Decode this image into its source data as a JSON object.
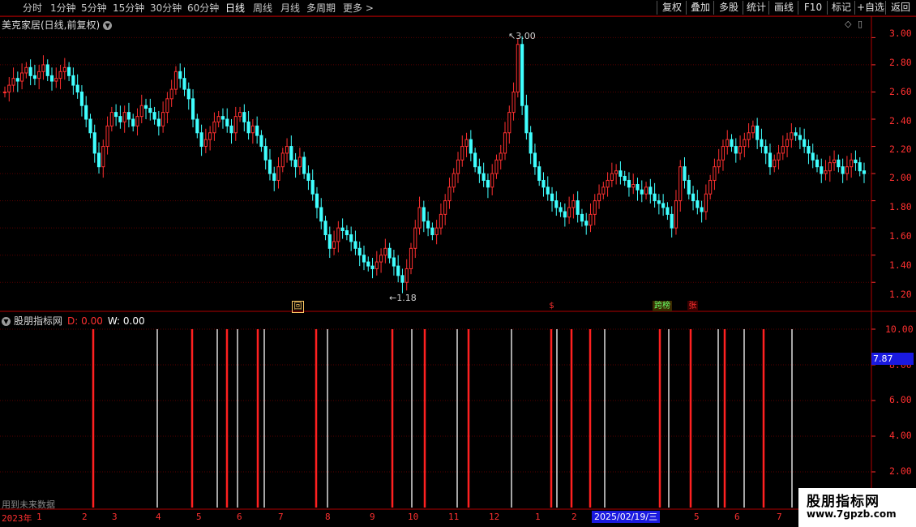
{
  "toolbar": {
    "periods": [
      "分时",
      "1分钟",
      "5分钟",
      "15分钟",
      "30分钟",
      "60分钟",
      "日线",
      "周线",
      "月线",
      "多周期",
      "更多"
    ],
    "active_period": "日线",
    "right_buttons": [
      "复权",
      "叠加",
      "多股",
      "统计",
      "画线",
      "F10",
      "标记",
      "+自选",
      "返回"
    ]
  },
  "main": {
    "title": "美克家居(日线,前复权)",
    "high_label": "3.00",
    "low_label": "1.18",
    "y_ticks": [
      "3.00",
      "2.80",
      "2.60",
      "2.40",
      "2.20",
      "2.00",
      "1.80",
      "1.60",
      "1.40",
      "1.20"
    ],
    "signals": [
      {
        "text": "回",
        "color": "#ffcc66"
      },
      {
        "text": "$",
        "color": "#ff3030"
      },
      {
        "text": "跨榜",
        "color": "#66ff66"
      },
      {
        "text": "张",
        "color": "#ff3030"
      }
    ]
  },
  "indicator": {
    "title": "股朋指标网",
    "d_label": "D: 0.00",
    "w_label": "W: 0.00",
    "y_ticks": [
      "10.00",
      "8.00",
      "6.00",
      "4.00",
      "2.00"
    ],
    "current_value": "7.87",
    "future_note": "用到未来数据"
  },
  "time_axis": {
    "labels": [
      "2023年",
      "1",
      "2",
      "3",
      "4",
      "5",
      "6",
      "7",
      "8",
      "9",
      "10",
      "11",
      "12",
      "1",
      "2",
      "5",
      "6",
      "7"
    ],
    "cursor_date": "2025/02/19/三"
  },
  "watermark": {
    "line1": "股朋指标网",
    "line2": "www.7gpzb.com"
  },
  "colors": {
    "up": "#ff3030",
    "down": "#40ffff",
    "bg": "#000000",
    "grid": "#5a0000",
    "white": "#ffffff"
  },
  "chart_data": {
    "type": "candlestick",
    "ylim": [
      1.1,
      3.05
    ],
    "closes": [
      2.6,
      2.65,
      2.7,
      2.68,
      2.74,
      2.78,
      2.72,
      2.7,
      2.75,
      2.8,
      2.72,
      2.68,
      2.7,
      2.75,
      2.78,
      2.72,
      2.65,
      2.6,
      2.5,
      2.4,
      2.3,
      2.15,
      2.05,
      2.2,
      2.35,
      2.45,
      2.42,
      2.38,
      2.45,
      2.4,
      2.35,
      2.42,
      2.5,
      2.48,
      2.45,
      2.4,
      2.35,
      2.45,
      2.55,
      2.62,
      2.75,
      2.7,
      2.62,
      2.55,
      2.4,
      2.3,
      2.2,
      2.25,
      2.3,
      2.38,
      2.42,
      2.4,
      2.35,
      2.3,
      2.42,
      2.45,
      2.38,
      2.3,
      2.35,
      2.28,
      2.2,
      2.1,
      2.0,
      1.95,
      2.05,
      2.15,
      2.2,
      2.1,
      2.05,
      2.12,
      2.0,
      1.95,
      1.85,
      1.75,
      1.65,
      1.55,
      1.45,
      1.5,
      1.6,
      1.58,
      1.55,
      1.5,
      1.45,
      1.4,
      1.35,
      1.32,
      1.3,
      1.35,
      1.4,
      1.45,
      1.38,
      1.32,
      1.25,
      1.2,
      1.3,
      1.45,
      1.6,
      1.75,
      1.65,
      1.6,
      1.55,
      1.6,
      1.7,
      1.8,
      1.9,
      2.0,
      2.1,
      2.2,
      2.25,
      2.15,
      2.05,
      2.0,
      1.95,
      1.9,
      2.0,
      2.1,
      2.15,
      2.3,
      2.45,
      2.6,
      2.95,
      2.5,
      2.3,
      2.15,
      2.05,
      1.95,
      1.9,
      1.85,
      1.8,
      1.75,
      1.72,
      1.68,
      1.75,
      1.8,
      1.7,
      1.65,
      1.62,
      1.7,
      1.8,
      1.85,
      1.9,
      1.95,
      2.0,
      2.02,
      1.98,
      1.95,
      1.9,
      1.92,
      1.88,
      1.85,
      1.9,
      1.85,
      1.8,
      1.78,
      1.75,
      1.7,
      1.6,
      1.8,
      2.05,
      1.95,
      1.85,
      1.8,
      1.75,
      1.72,
      1.85,
      1.95,
      2.05,
      2.1,
      2.2,
      2.25,
      2.2,
      2.15,
      2.2,
      2.25,
      2.3,
      2.35,
      2.25,
      2.2,
      2.15,
      2.05,
      2.1,
      2.15,
      2.2,
      2.25,
      2.3,
      2.28,
      2.25,
      2.2,
      2.15,
      2.1,
      2.05,
      2.0,
      2.02,
      2.08,
      2.1,
      2.05,
      2.0,
      2.05,
      2.1,
      2.08,
      2.02,
      2.0
    ],
    "indicator_bars": [
      {
        "x": 115,
        "c": "r"
      },
      {
        "x": 194,
        "c": "w"
      },
      {
        "x": 237,
        "c": "r"
      },
      {
        "x": 268,
        "c": "w"
      },
      {
        "x": 280,
        "c": "r"
      },
      {
        "x": 293,
        "c": "w"
      },
      {
        "x": 318,
        "c": "r"
      },
      {
        "x": 326,
        "c": "w"
      },
      {
        "x": 390,
        "c": "r"
      },
      {
        "x": 404,
        "c": "w"
      },
      {
        "x": 484,
        "c": "r"
      },
      {
        "x": 508,
        "c": "w"
      },
      {
        "x": 524,
        "c": "r"
      },
      {
        "x": 564,
        "c": "w"
      },
      {
        "x": 578,
        "c": "r"
      },
      {
        "x": 631,
        "c": "w"
      },
      {
        "x": 680,
        "c": "r"
      },
      {
        "x": 687,
        "c": "w"
      },
      {
        "x": 705,
        "c": "r"
      },
      {
        "x": 728,
        "c": "r"
      },
      {
        "x": 746,
        "c": "w"
      },
      {
        "x": 814,
        "c": "r"
      },
      {
        "x": 825,
        "c": "w"
      },
      {
        "x": 852,
        "c": "r"
      },
      {
        "x": 886,
        "c": "w"
      },
      {
        "x": 894,
        "c": "r"
      },
      {
        "x": 918,
        "c": "w"
      },
      {
        "x": 942,
        "c": "r"
      },
      {
        "x": 977,
        "c": "w"
      }
    ]
  }
}
